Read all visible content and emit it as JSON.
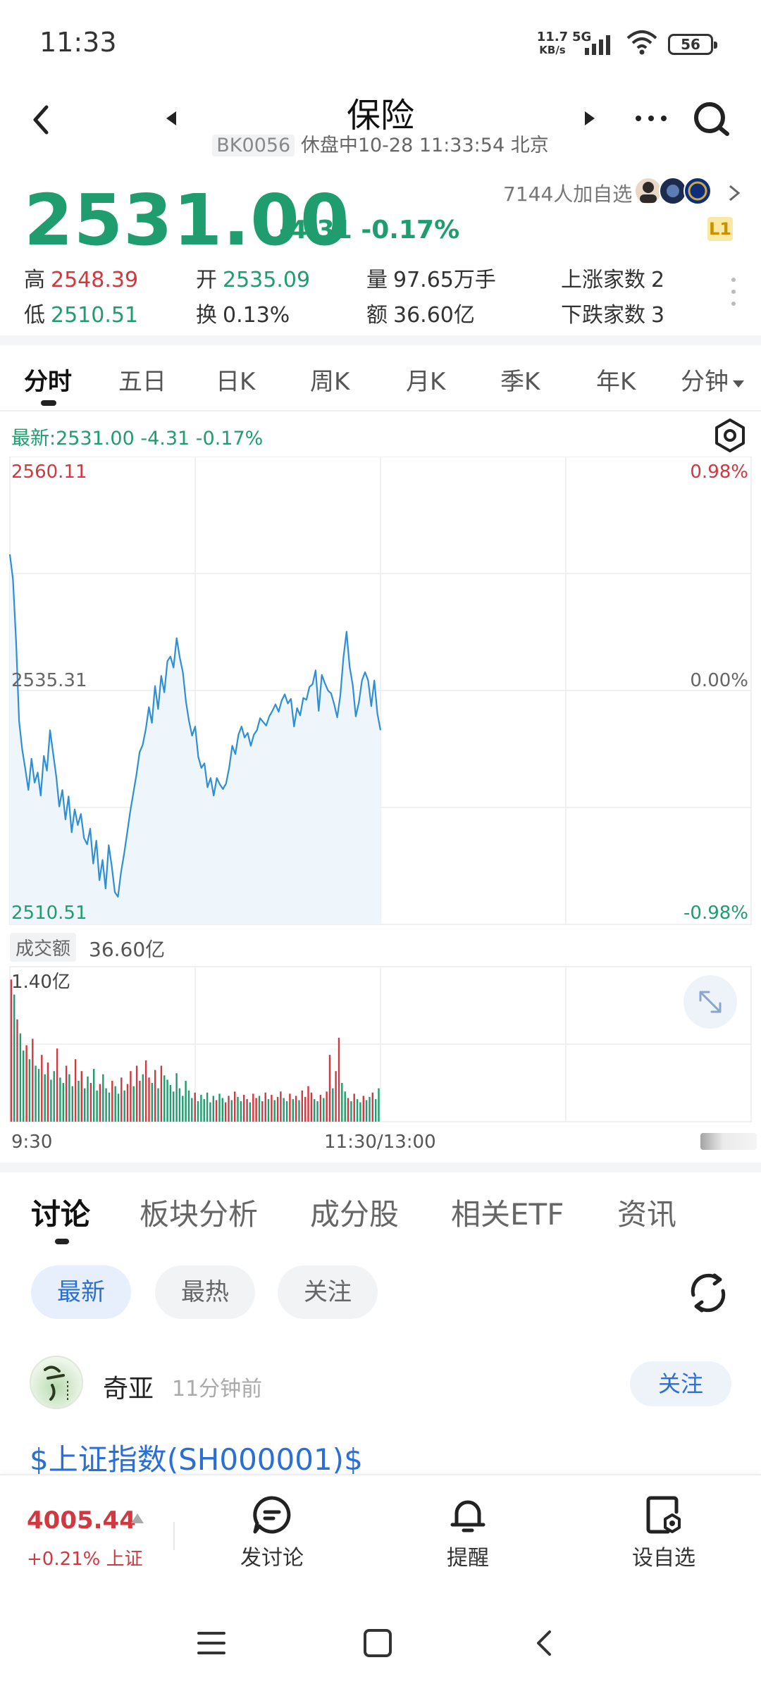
{
  "status_bar": {
    "time": "11:33",
    "net_speed_value": "11.7",
    "net_speed_unit": "KB/s",
    "network": "5G",
    "battery": "56"
  },
  "header": {
    "title": "保险",
    "code": "BK0056",
    "status_line": " 休盘中10-28 11:33:54 北京"
  },
  "quote": {
    "price": "2531.00",
    "change": "-4.31",
    "change_pct": "-0.17%",
    "followers": "7144人加自选",
    "level_badge": "L1",
    "stats": {
      "high_label": "高",
      "high": "2548.39",
      "low_label": "低",
      "low": "2510.51",
      "open_label": "开",
      "open": "2535.09",
      "turnover_rate_label": "换",
      "turnover_rate": "0.13%",
      "volume_label": "量",
      "volume": "97.65万手",
      "amount_label": "额",
      "amount": "36.60亿",
      "advancers_label": "上涨家数",
      "advancers": "2",
      "decliners_label": "下跌家数",
      "decliners": "3"
    }
  },
  "chart_tabs": [
    "分时",
    "五日",
    "日K",
    "周K",
    "月K",
    "季K",
    "年K",
    "分钟"
  ],
  "chart_tabs_active": 0,
  "chart_header": {
    "latest_line": "最新:2531.00  -4.31  -0.17%"
  },
  "chart_data": {
    "type": "line",
    "title": "",
    "x_labels": [
      "9:30",
      "11:30/13:00"
    ],
    "ylim": [
      2510.51,
      2560.11
    ],
    "y_left_labels": [
      "2560.11",
      "2535.31",
      "2510.51"
    ],
    "y_right_labels": [
      "0.98%",
      "0.00%",
      "-0.98%"
    ],
    "prev_close": 2535.31,
    "series": [
      {
        "values": [
          2550.1,
          2547.4,
          2540.7,
          2532.0,
          2528.9,
          2526.8,
          2524.5,
          2527.9,
          2525.3,
          2526.4,
          2523.9,
          2528.2,
          2526.6,
          2531.0,
          2528.5,
          2526.0,
          2522.7,
          2524.5,
          2521.3,
          2523.8,
          2519.9,
          2522.4,
          2520.7,
          2521.9,
          2519.3,
          2518.6,
          2520.3,
          2516.5,
          2519.0,
          2514.7,
          2516.9,
          2513.8,
          2518.5,
          2516.2,
          2513.4,
          2512.9,
          2515.6,
          2517.6,
          2519.9,
          2522.2,
          2524.2,
          2526.2,
          2528.6,
          2529.4,
          2531.1,
          2533.5,
          2531.8,
          2535.8,
          2533.3,
          2536.9,
          2535.1,
          2538.5,
          2539.0,
          2537.8,
          2541.0,
          2538.9,
          2537.3,
          2534.1,
          2532.0,
          2530.4,
          2531.4,
          2528.1,
          2526.9,
          2527.4,
          2524.8,
          2525.8,
          2523.9,
          2525.8,
          2525.1,
          2524.6,
          2525.2,
          2526.9,
          2529.3,
          2528.4,
          2530.5,
          2531.4,
          2530.2,
          2530.7,
          2529.3,
          2530.5,
          2531.0,
          2532.3,
          2531.9,
          2531.5,
          2532.5,
          2533.1,
          2533.8,
          2533.0,
          2534.2,
          2534.9,
          2533.9,
          2534.4,
          2531.4,
          2533.4,
          2532.6,
          2534.5,
          2534.3,
          2535.7,
          2536.0,
          2537.5,
          2533.1,
          2537.0,
          2536.1,
          2535.3,
          2535.0,
          2533.8,
          2532.4,
          2534.8,
          2538.9,
          2541.7,
          2537.9,
          2535.9,
          2532.5,
          2534.0,
          2536.4,
          2537.3,
          2536.4,
          2533.6,
          2536.4,
          2532.8,
          2531.0
        ]
      }
    ]
  },
  "volume_chart": {
    "label": "成交额",
    "total": "36.60亿",
    "max_label": "1.40亿",
    "values": [
      1.32,
      1.18,
      0.95,
      0.82,
      0.66,
      0.71,
      0.58,
      0.77,
      0.52,
      0.49,
      0.62,
      0.44,
      0.55,
      0.39,
      0.47,
      0.68,
      0.41,
      0.36,
      0.52,
      0.44,
      0.33,
      0.58,
      0.38,
      0.47,
      0.31,
      0.42,
      0.36,
      0.49,
      0.29,
      0.35,
      0.44,
      0.31,
      0.27,
      0.38,
      0.33,
      0.26,
      0.41,
      0.29,
      0.35,
      0.47,
      0.33,
      0.52,
      0.38,
      0.44,
      0.57,
      0.41,
      0.36,
      0.48,
      0.31,
      0.52,
      0.43,
      0.39,
      0.34,
      0.28,
      0.45,
      0.31,
      0.24,
      0.38,
      0.29,
      0.22,
      0.27,
      0.19,
      0.25,
      0.21,
      0.27,
      0.18,
      0.24,
      0.2,
      0.26,
      0.22,
      0.18,
      0.24,
      0.2,
      0.28,
      0.23,
      0.19,
      0.25,
      0.21,
      0.18,
      0.26,
      0.22,
      0.24,
      0.19,
      0.27,
      0.21,
      0.25,
      0.2,
      0.23,
      0.28,
      0.22,
      0.19,
      0.26,
      0.21,
      0.24,
      0.2,
      0.29,
      0.23,
      0.33,
      0.27,
      0.21,
      0.19,
      0.25,
      0.22,
      0.28,
      0.62,
      0.31,
      0.47,
      0.78,
      0.36,
      0.28,
      0.22,
      0.19,
      0.26,
      0.21,
      0.18,
      0.24,
      0.2,
      0.23,
      0.27,
      0.21,
      0.31
    ],
    "up": [
      1,
      0,
      1,
      0,
      0,
      1,
      0,
      1,
      0,
      0,
      1,
      0,
      1,
      0,
      0,
      1,
      0,
      0,
      1,
      0,
      0,
      1,
      0,
      1,
      0,
      0,
      1,
      0,
      0,
      1,
      0,
      0,
      0,
      1,
      0,
      0,
      1,
      0,
      1,
      1,
      0,
      1,
      1,
      0,
      1,
      1,
      0,
      1,
      0,
      1,
      0,
      0,
      0,
      0,
      0,
      0,
      0,
      0,
      0,
      0,
      1,
      0,
      0,
      0,
      0,
      0,
      0,
      1,
      0,
      0,
      1,
      1,
      0,
      1,
      0,
      0,
      1,
      1,
      0,
      1,
      1,
      0,
      1,
      1,
      0,
      1,
      0,
      1,
      1,
      0,
      0,
      1,
      0,
      1,
      0,
      1,
      1,
      1,
      1,
      0,
      0,
      1,
      0,
      1,
      1,
      0,
      1,
      1,
      0,
      0,
      1,
      0,
      1,
      0,
      0,
      1,
      0,
      0,
      1,
      0,
      0
    ]
  },
  "discussion_tabs": [
    "讨论",
    "板块分析",
    "成分股",
    "相关ETF",
    "资讯"
  ],
  "discussion_tabs_active": 0,
  "filter_pills": [
    "最新",
    "最热",
    "关注"
  ],
  "filter_pills_active": 0,
  "post": {
    "user": "奇亚",
    "time": "11分钟前",
    "follow_label": "关注",
    "text": "$上证指数(SH000001)$"
  },
  "bottom_bar": {
    "index_value": "4005.44",
    "index_change": "+0.21% 上证",
    "discuss_label": "发讨论",
    "alert_label": "提醒",
    "watchlist_label": "设自选"
  },
  "colors": {
    "up": "#d2383f",
    "down": "#1f9d6e",
    "line": "#2f8fd6",
    "accent": "#2b6fd6"
  },
  "icons": [
    "back-icon",
    "prev-arrow-icon",
    "next-arrow-icon",
    "more-icon",
    "search-icon",
    "settings-icon",
    "expand-icon",
    "refresh-icon",
    "chat-icon",
    "bell-icon",
    "watchlist-icon"
  ]
}
